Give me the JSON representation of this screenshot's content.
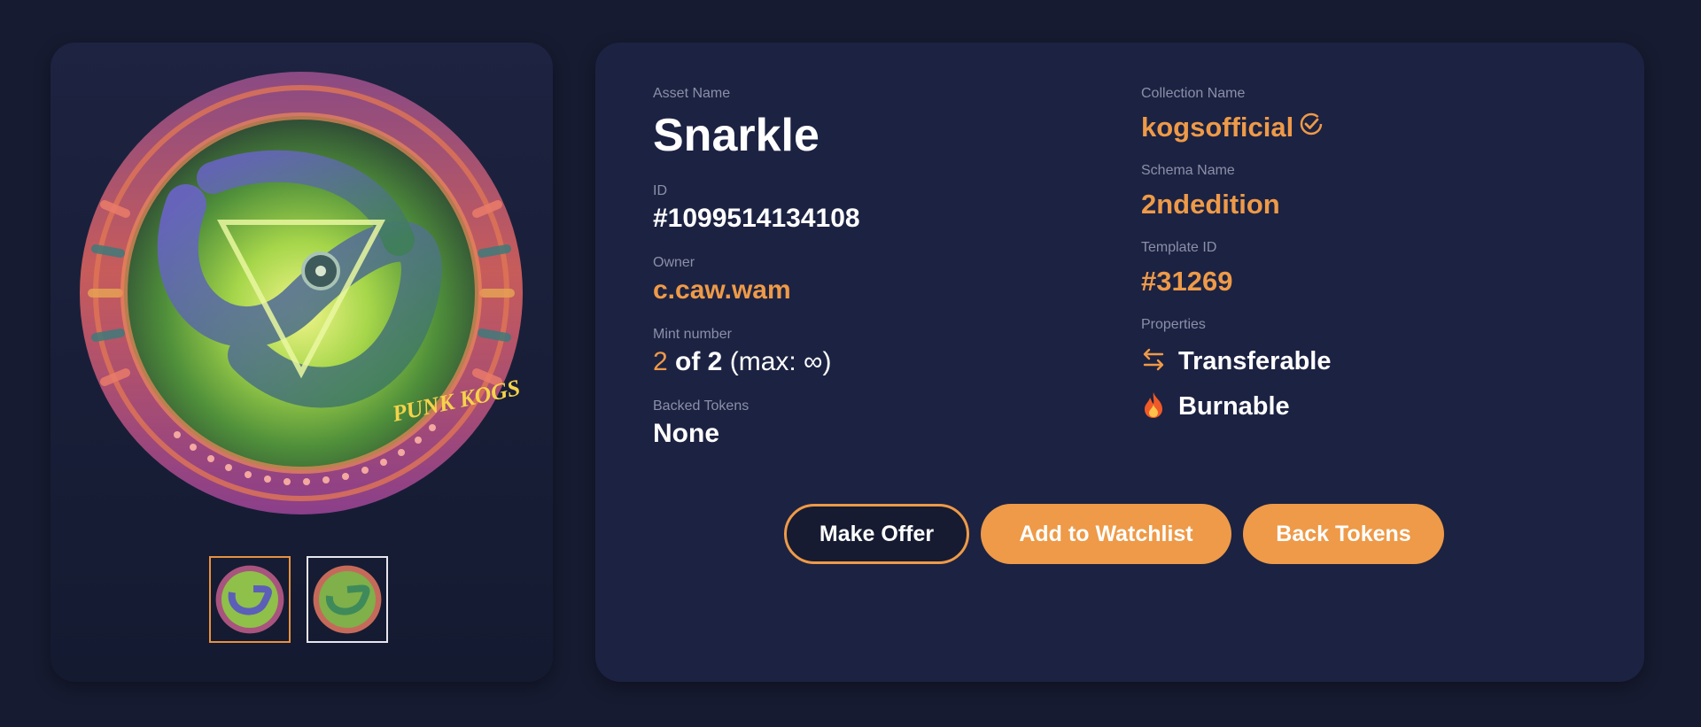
{
  "colors": {
    "accent": "#ee9a48",
    "background": "#161b31",
    "card": "#1c2242"
  },
  "gallery": {
    "main_image": "snarkle-kog-artwork",
    "art_text": "PUNK KOGS",
    "thumbnails": [
      {
        "name": "thumbnail-1",
        "selected": true
      },
      {
        "name": "thumbnail-2",
        "selected": false
      }
    ]
  },
  "asset": {
    "name_label": "Asset Name",
    "name": "Snarkle",
    "id_label": "ID",
    "id": "#1099514134108",
    "owner_label": "Owner",
    "owner": "c.caw.wam",
    "mint_label": "Mint number",
    "mint_number": "2",
    "mint_of": "of 2",
    "mint_max": "(max: ∞)",
    "backed_label": "Backed Tokens",
    "backed": "None"
  },
  "collection": {
    "name_label": "Collection Name",
    "name": "kogsofficial",
    "verified_icon": "verified-check-icon",
    "schema_label": "Schema Name",
    "schema": "2ndedition",
    "template_label": "Template ID",
    "template_id": "#31269",
    "properties_label": "Properties",
    "properties": [
      {
        "label": "Transferable",
        "icon": "transfer-arrows-icon"
      },
      {
        "label": "Burnable",
        "icon": "fire-icon"
      }
    ]
  },
  "actions": {
    "make_offer": "Make Offer",
    "add_watchlist": "Add to Watchlist",
    "back_tokens": "Back Tokens"
  }
}
